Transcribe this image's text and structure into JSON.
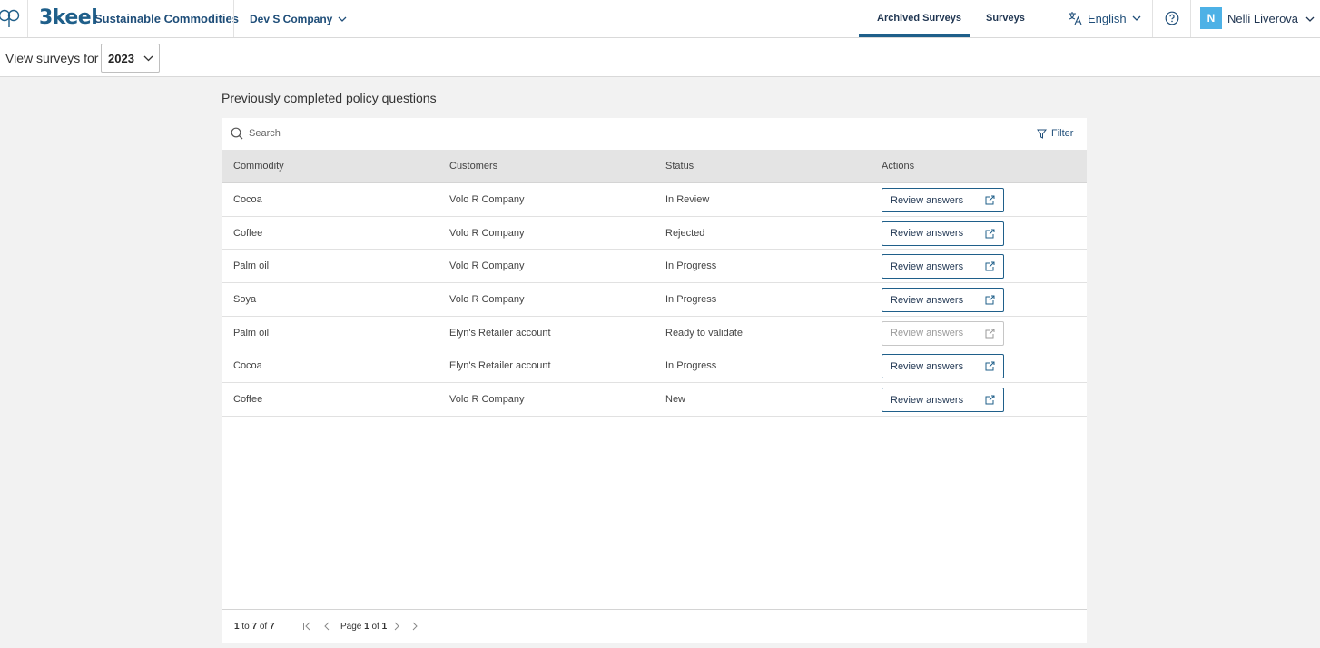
{
  "header": {
    "brand_logo": "3keel",
    "brand_name": "Sustainable Commodities",
    "company": "Dev S Company",
    "tabs": [
      {
        "label": "Archived Surveys",
        "active": true
      },
      {
        "label": "Surveys",
        "active": false
      }
    ],
    "language": "English",
    "user_initial": "N",
    "user_name": "Nelli Liverova",
    "accent_color": "#1f5f8a",
    "avatar_color": "#4db1e6"
  },
  "subbar": {
    "view_label": "View surveys for",
    "year": "2023"
  },
  "main": {
    "heading": "Previously completed policy questions",
    "search_placeholder": "Search",
    "filter_label": "Filter",
    "columns": [
      "Commodity",
      "Customers",
      "Status",
      "Actions"
    ],
    "rows": [
      {
        "commodity": "Cocoa",
        "customer": "Volo R Company",
        "status": "In Review",
        "action": "Review answers",
        "enabled": true
      },
      {
        "commodity": "Coffee",
        "customer": "Volo R Company",
        "status": "Rejected",
        "action": "Review answers",
        "enabled": true
      },
      {
        "commodity": "Palm oil",
        "customer": "Volo R Company",
        "status": "In Progress",
        "action": "Review answers",
        "enabled": true
      },
      {
        "commodity": "Soya",
        "customer": "Volo R Company",
        "status": "In Progress",
        "action": "Review answers",
        "enabled": true
      },
      {
        "commodity": "Palm oil",
        "customer": "Elyn's Retailer account",
        "status": "Ready to validate",
        "action": "Review answers",
        "enabled": false
      },
      {
        "commodity": "Cocoa",
        "customer": "Elyn's Retailer account",
        "status": "In Progress",
        "action": "Review answers",
        "enabled": true
      },
      {
        "commodity": "Coffee",
        "customer": "Volo R Company",
        "status": "New",
        "action": "Review answers",
        "enabled": true
      }
    ],
    "pagination": {
      "from": "1",
      "to": "7",
      "total": "7",
      "page": "1",
      "pages": "1",
      "to_word": "to",
      "of_word": "of",
      "page_word": "Page"
    }
  }
}
